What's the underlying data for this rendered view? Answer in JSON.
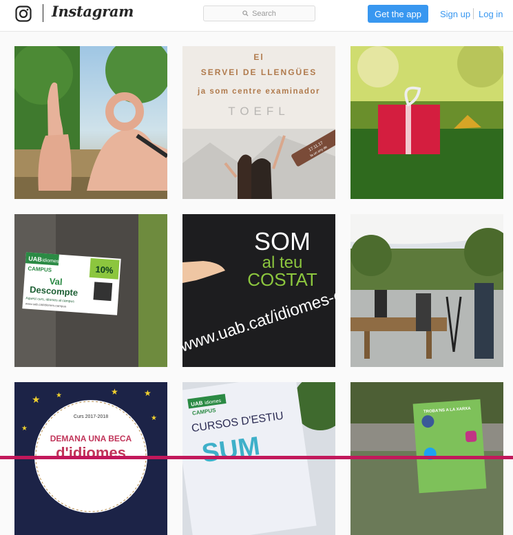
{
  "header": {
    "wordmark": "Instagram",
    "search_placeholder": "Search",
    "get_app_label": "Get the app",
    "signup_label": "Sign up",
    "login_label": "Log in"
  },
  "posts": [
    {
      "id": "post-1",
      "overlay_text": []
    },
    {
      "id": "post-2",
      "overlay_text": [
        "El",
        "SERVEI DE LLENGÜES",
        "ja som centre examinador",
        "TOEFL",
        "17.11.17",
        "fa un any de"
      ]
    },
    {
      "id": "post-3",
      "overlay_text": []
    },
    {
      "id": "post-4",
      "overlay_text": [
        "UAB",
        "idiomes",
        "CAMPUS",
        "10%",
        "Val",
        "Descompte",
        "Aquest curs, idiomes al campus",
        "www.uab.cat/idiomes-campus"
      ]
    },
    {
      "id": "post-5",
      "overlay_text": [
        "SOM",
        "al teu",
        "COSTAT",
        "www.uab.cat/idiomes-campus"
      ]
    },
    {
      "id": "post-6",
      "overlay_text": []
    },
    {
      "id": "post-7",
      "overlay_text": [
        "Curs 2017-2018",
        "DEMANA UNA BECA",
        "d'idiomes"
      ]
    },
    {
      "id": "post-8",
      "overlay_text": [
        "UAB",
        "idiomes",
        "CAMPUS",
        "CURSOS D'ESTIU",
        "SUM"
      ]
    },
    {
      "id": "post-9",
      "overlay_text": [
        "TROBA'NS A LA XARXA"
      ]
    }
  ],
  "colors": {
    "accent": "#3897f0",
    "header_bg": "#ffffff",
    "page_bg": "#fafafa",
    "bottom_strip": "#c2185b"
  }
}
